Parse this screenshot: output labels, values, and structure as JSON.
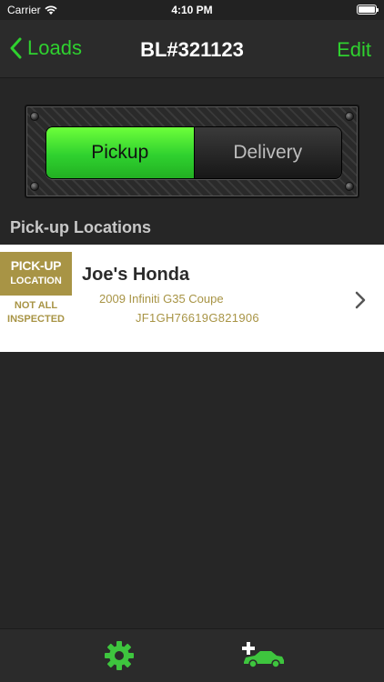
{
  "status": {
    "carrier": "Carrier",
    "time": "4:10 PM"
  },
  "nav": {
    "back_label": "Loads",
    "title": "BL#321123",
    "edit_label": "Edit"
  },
  "segment": {
    "pickup_label": "Pickup",
    "delivery_label": "Delivery",
    "selected": "Pickup"
  },
  "section": {
    "title": "Pick-up Locations"
  },
  "locations": [
    {
      "badge_line1": "PICK-UP",
      "badge_line2": "LOCATION",
      "inspection_status_line1": "NOT ALL",
      "inspection_status_line2": "INSPECTED",
      "name": "Joe's Honda",
      "vehicle": "2009 Infiniti G35 Coupe",
      "vin": "JF1GH76619G821906"
    }
  ],
  "tab_bar": {
    "settings_icon": "gear-icon",
    "add_car_icon": "add-car-icon"
  },
  "colors": {
    "accent_green": "#2fd12f",
    "badge_gold": "#a89445",
    "background": "#262626"
  }
}
